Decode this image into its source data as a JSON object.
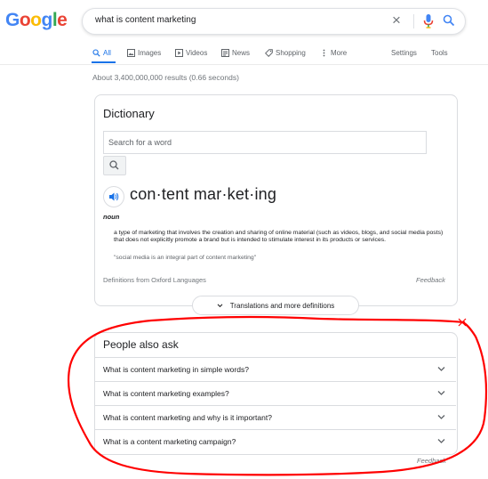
{
  "logo": {
    "letters": [
      "G",
      "o",
      "o",
      "g",
      "l",
      "e"
    ],
    "colors": [
      "#4285f4",
      "#ea4335",
      "#fbbc05",
      "#4285f4",
      "#34a853",
      "#ea4335"
    ]
  },
  "search": {
    "query": "what is content marketing",
    "clear_icon": "close-icon",
    "mic_icon": "microphone-icon",
    "search_icon": "search-icon"
  },
  "tabs": {
    "all": "All",
    "images": "Images",
    "videos": "Videos",
    "news": "News",
    "shopping": "Shopping",
    "more": "More",
    "settings": "Settings",
    "tools": "Tools"
  },
  "stats": "About 3,400,000,000 results (0.66 seconds)",
  "dictionary": {
    "title": "Dictionary",
    "search_placeholder": "Search for a word",
    "headword": "con·tent mar·ket·ing",
    "part_of_speech": "noun",
    "definition": "a type of marketing that involves the creation and sharing of online material (such as videos, blogs, and social media posts) that does not explicitly promote a brand but is intended to stimulate interest in its products or services.",
    "example": "\"social media is an integral part of content marketing\"",
    "source": "Definitions from Oxford Languages",
    "feedback": "Feedback",
    "translations_button": "Translations and more definitions"
  },
  "people_also_ask": {
    "title": "People also ask",
    "questions": [
      "What is content marketing in simple words?",
      "What is content marketing examples?",
      "What is content marketing and why is it important?",
      "What is a content marketing campaign?"
    ],
    "feedback": "Feedback"
  },
  "colors": {
    "accent": "#1a73e8",
    "annotation": "#ff0000",
    "border": "#dadce0"
  }
}
